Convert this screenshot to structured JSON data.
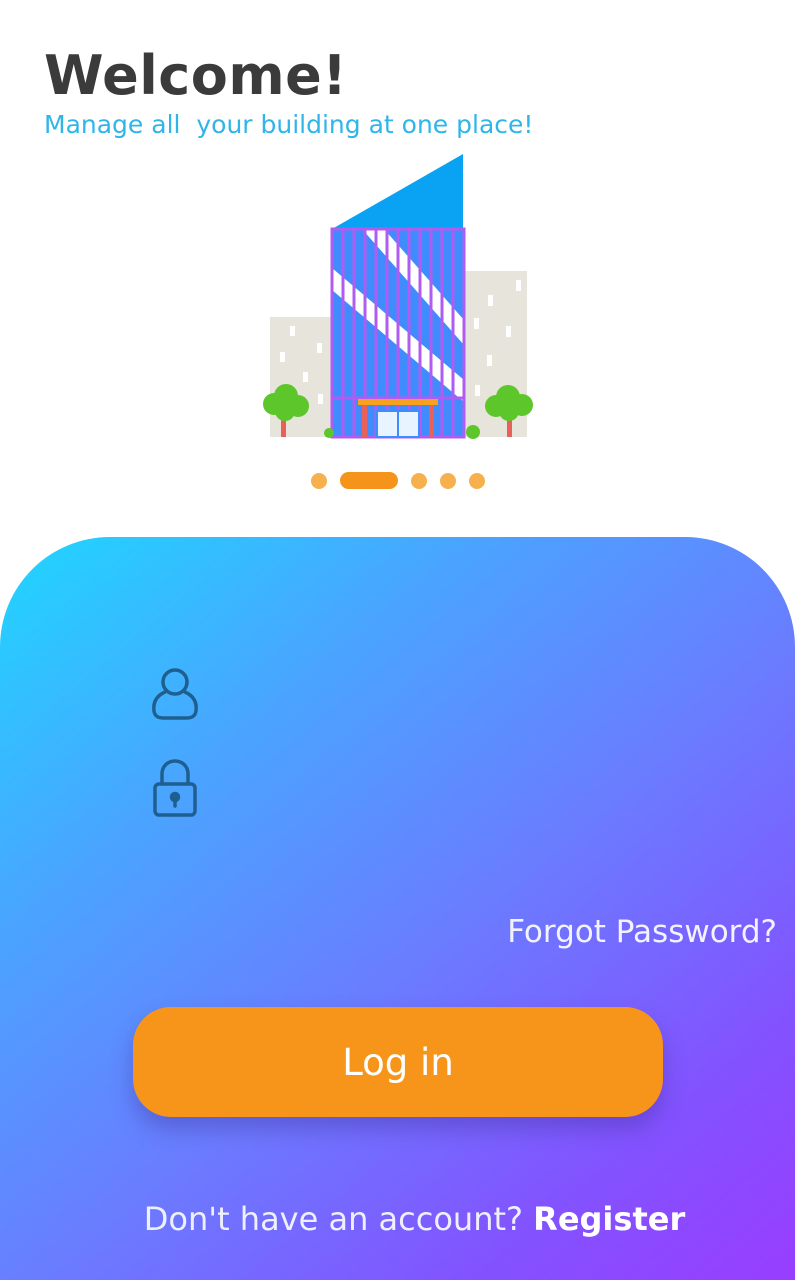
{
  "header": {
    "title": "Welcome!",
    "subtitle": "Manage all  your building at one place!"
  },
  "illustration": {
    "icon": "building-illustration"
  },
  "carousel": {
    "count": 5,
    "active_index": 1
  },
  "form": {
    "username": {
      "icon": "user-icon",
      "value": ""
    },
    "password": {
      "icon": "lock-icon",
      "value": ""
    },
    "forgot_label": "Forgot Password?",
    "login_label": "Log in",
    "no_account_text": "Don't have an account?",
    "register_label": "Register"
  },
  "colors": {
    "accent": "#f6931a",
    "subtitle": "#2fb5e8",
    "gradient_start": "#1fd6ff",
    "gradient_end": "#9a3cff",
    "icon_stroke": "#1f5f8f"
  }
}
